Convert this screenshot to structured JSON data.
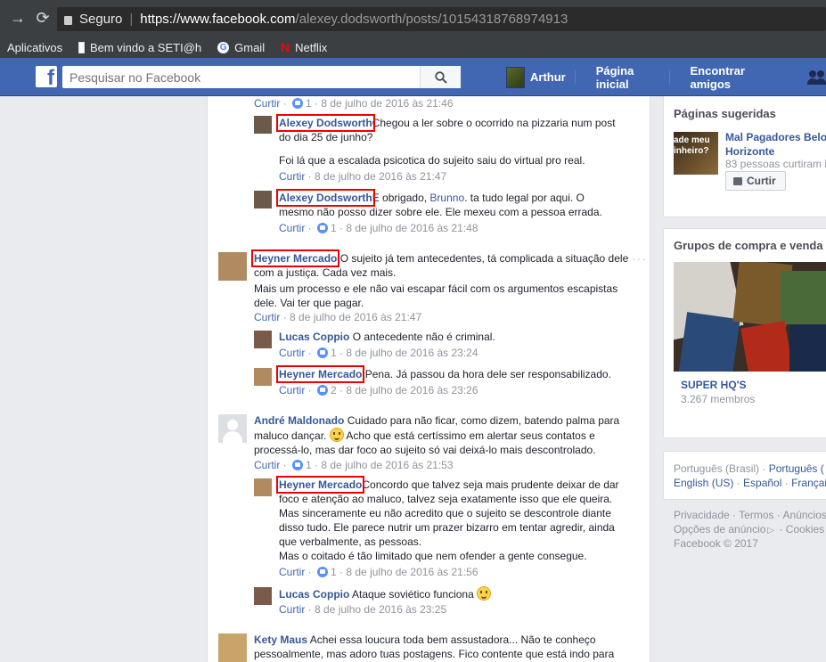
{
  "browser": {
    "secure_label": "Seguro",
    "url_domain": "https://www.facebook.com",
    "url_path": "/alexey.dodsworth/posts/10154318768974913"
  },
  "bookmarks": [
    {
      "label": "Aplicativos"
    },
    {
      "label": "Bem vindo a SETI@h"
    },
    {
      "label": "Gmail"
    },
    {
      "label": "Netflix"
    }
  ],
  "header": {
    "search_placeholder": "Pesquisar no Facebook",
    "user": "Arthur",
    "home": "Página inicial",
    "find_friends": "Encontrar amigos"
  },
  "comments": {
    "top_meta": {
      "like": "Curtir",
      "count": "1",
      "date": "8 de julho de 2016 às 21:46"
    },
    "c1": {
      "name": "Alexey Dodsworth",
      "text": "Chegou a ler sobre o ocorrido na pizzaria num post do dia 25 de junho?",
      "text2": "Foi lá que a escalada psicotica do sujeito saiu do virtual pro real.",
      "like": "Curtir",
      "date": "8 de julho de 2016 às 21:47"
    },
    "c2": {
      "name": "Alexey Dodsworth",
      "text_a": "E obrigado, ",
      "mention": "Brunno",
      "text_b": ". ta tudo legal por aqui. O mesmo não posso dizer sobre ele. Ele mexeu com a pessoa errada.",
      "like": "Curtir",
      "count": "1",
      "date": "8 de julho de 2016 às 21:48"
    },
    "c3": {
      "name": "Heyner Mercado",
      "text": "O sujeito já tem antecedentes, tá complicada a situação dele com a justiça. Cada vez mais.",
      "text2": "Mais um processo e ele não vai escapar fácil com os argumentos escapistas dele. Vai ter que pagar.",
      "like": "Curtir",
      "date": "8 de julho de 2016 às 21:47"
    },
    "c4": {
      "name": "Lucas Coppio",
      "text": "O antecedente não é criminal.",
      "like": "Curtir",
      "count": "1",
      "date": "8 de julho de 2016 às 23:24"
    },
    "c5": {
      "name": "Heyner Mercado",
      "text": "Pena. Já passou da hora dele ser responsabilizado.",
      "like": "Curtir",
      "count": "2",
      "date": "8 de julho de 2016 às 23:26"
    },
    "c6": {
      "name": "André Maldonado",
      "text_a": "Cuidado para não ficar, como dizem, batendo palma para maluco dançar. ",
      "text_b": " Acho que está certíssimo em alertar seus contatos e processá-lo, mas dar foco ao sujeito só vai deixá-lo mais descontrolado.",
      "like": "Curtir",
      "count": "1",
      "date": "8 de julho de 2016 às 21:53"
    },
    "c7": {
      "name": "Heyner Mercado",
      "text": "Concordo que talvez seja mais prudente deixar de dar foco e atenção ao maluco, talvez seja exatamente isso que ele queira. Mas sinceramente eu não acredito que o sujeito se descontrole diante disso tudo. Ele parece nutrir um prazer bizarro em tentar agredir, ainda que verbalmente, as pessoas.",
      "text2": "Mas o coitado é tão limitado que nem ofender a gente consegue.",
      "like": "Curtir",
      "count": "1",
      "date": "8 de julho de 2016 às 21:56"
    },
    "c8": {
      "name": "Lucas Coppio",
      "text": "Ataque soviético funciona ",
      "like": "Curtir",
      "date": "8 de julho de 2016 às 23:25"
    },
    "c9": {
      "name": "Kety Maus",
      "text": "Achei essa loucura toda bem assustadora... Não te conheço pessoalmente, mas adoro tuas postagens. Fico contente que está indo para"
    }
  },
  "sidebar": {
    "pages_title": "Páginas sugeridas",
    "page_name": "Mal Pagadores Belo Horizonte",
    "page_likes": "83 pessoas curtiram i",
    "page_like_btn": "Curtir",
    "page_thumb_text": "ade meu inheiro?",
    "groups_title": "Grupos de compra e venda",
    "group_name": "SUPER HQ'S",
    "group_members": "3.267 membros",
    "languages": [
      "Português (Brasil)",
      "Português (",
      "English (US)",
      "Español",
      "Françai"
    ],
    "links": [
      "Privacidade",
      "Termos",
      "Anúncios",
      "Opções de anúncio",
      "Cookies"
    ],
    "copyright": "Facebook © 2017"
  },
  "colors": {
    "fb_blue": "#4267b2",
    "link": "#365899",
    "highlight": "#e00000"
  }
}
